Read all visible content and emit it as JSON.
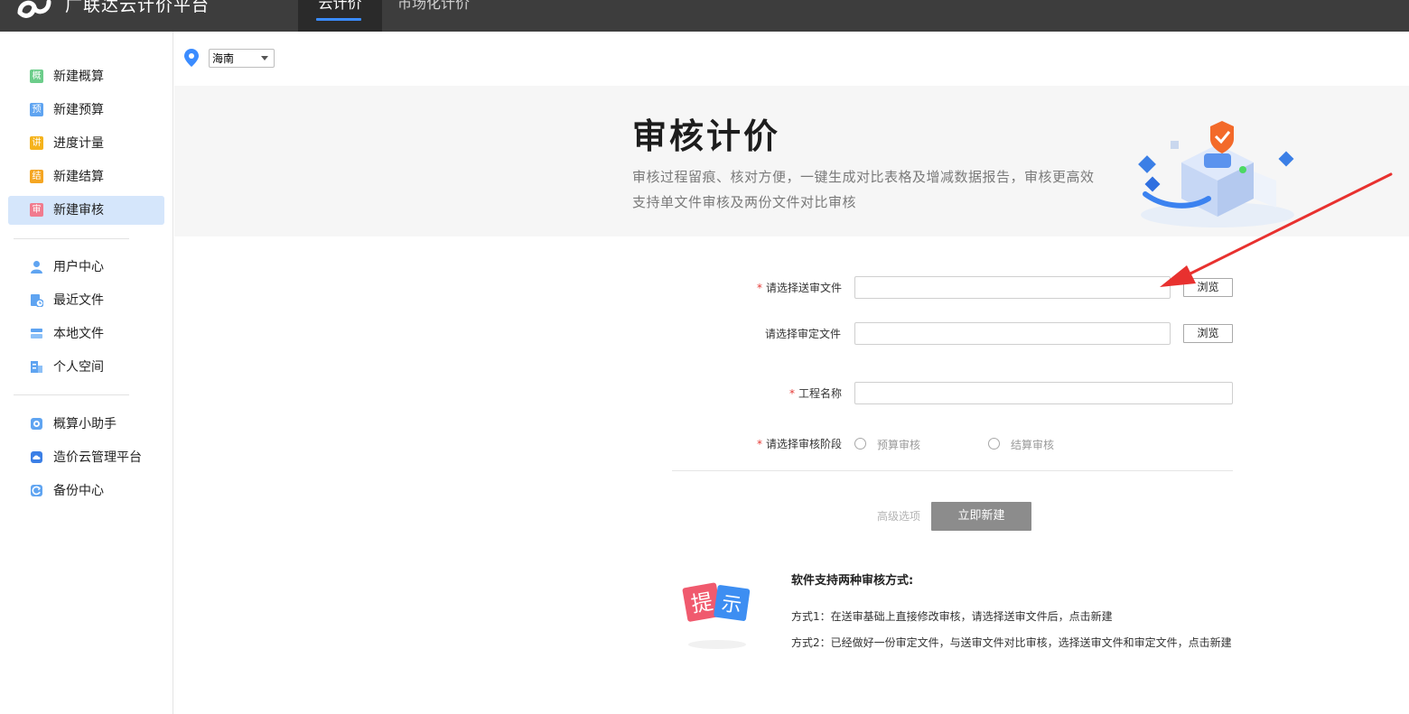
{
  "header": {
    "app_title": "广联达云计价平台",
    "tabs": [
      {
        "label": "云计价",
        "active": true
      },
      {
        "label": "市场化计价",
        "active": false
      }
    ],
    "accent_color": "#3b8cff"
  },
  "sidebar": {
    "groups": [
      [
        {
          "icon": "概",
          "icon_color": "#6ccd8a",
          "label": "新建概算"
        },
        {
          "icon": "预",
          "icon_color": "#5fa4f1",
          "label": "新建预算"
        },
        {
          "icon": "讲",
          "icon_color": "#f5b31c",
          "label": "进度计量"
        },
        {
          "icon": "结",
          "icon_color": "#f5a623",
          "label": "新建结算"
        },
        {
          "icon": "审",
          "icon_color": "#f17b8e",
          "label": "新建审核",
          "active": true
        }
      ],
      [
        {
          "icon": "user-icon",
          "label": "用户中心"
        },
        {
          "icon": "recent-file-icon",
          "label": "最近文件"
        },
        {
          "icon": "local-file-icon",
          "label": "本地文件"
        },
        {
          "icon": "personal-space-icon",
          "label": "个人空间"
        }
      ],
      [
        {
          "icon": "assistant-icon",
          "label": "概算小助手"
        },
        {
          "icon": "cloud-platform-icon",
          "label": "造价云管理平台"
        },
        {
          "icon": "backup-icon",
          "label": "备份中心"
        }
      ]
    ]
  },
  "region": {
    "selected": "海南"
  },
  "banner": {
    "title": "审核计价",
    "subtitle_line1": "审核过程留痕、核对方便，一键生成对比表格及增减数据报告，审核更高效",
    "subtitle_line2": "支持单文件审核及两份文件对比审核"
  },
  "form": {
    "submit_file": {
      "label": "请选择送审文件",
      "required": true,
      "value": "",
      "browse_label": "浏览"
    },
    "approved_file": {
      "label": "请选择审定文件",
      "required": false,
      "value": "",
      "browse_label": "浏览"
    },
    "project_name": {
      "label": "工程名称",
      "required": true,
      "value": ""
    },
    "stage": {
      "label": "请选择审核阶段",
      "required": true,
      "options": [
        "预算审核",
        "结算审核"
      ]
    },
    "advanced_label": "高级选项",
    "create_label": "立即新建"
  },
  "tips": {
    "badge_chars": [
      "提",
      "示"
    ],
    "title": "软件支持两种审核方式:",
    "method1": "方式1：在送审基础上直接修改审核，请选择送审文件后，点击新建",
    "method2": "方式2：已经做好一份审定文件，与送审文件对比审核，选择送审文件和审定文件，点击新建"
  },
  "annotation_color": "#e8312f"
}
